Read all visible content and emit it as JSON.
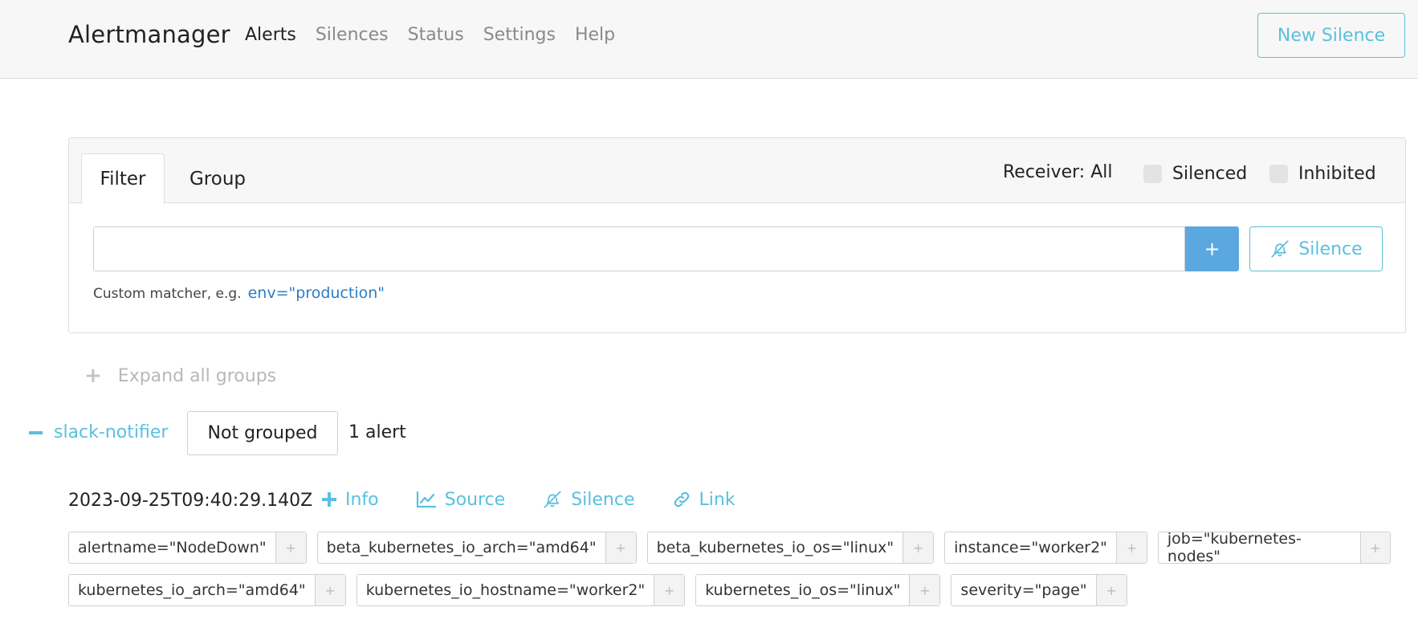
{
  "navbar": {
    "brand": "Alertmanager",
    "links": [
      "Alerts",
      "Silences",
      "Status",
      "Settings",
      "Help"
    ],
    "active_link": "Alerts",
    "new_silence_label": "New Silence"
  },
  "filter": {
    "tabs": [
      "Filter",
      "Group"
    ],
    "active_tab": "Filter",
    "receiver_label": "Receiver: All",
    "silenced_label": "Silenced",
    "inhibited_label": "Inhibited",
    "input_value": "",
    "add_button_label": "+",
    "silence_button_label": "Silence",
    "hint_text": "Custom matcher, e.g.",
    "hint_example": "env=\"production\""
  },
  "expand_all_label": "Expand all groups",
  "group": {
    "receiver": "slack-notifier",
    "grouping": "Not grouped",
    "count": "1 alert"
  },
  "alert": {
    "timestamp": "2023-09-25T09:40:29.140Z",
    "actions": {
      "info": "Info",
      "source": "Source",
      "silence": "Silence",
      "link": "Link"
    },
    "labels_row1": [
      "alertname=\"NodeDown\"",
      "beta_kubernetes_io_arch=\"amd64\"",
      "beta_kubernetes_io_os=\"linux\"",
      "instance=\"worker2\"",
      "job=\"kubernetes-nodes\""
    ],
    "labels_row2": [
      "kubernetes_io_arch=\"amd64\"",
      "kubernetes_io_hostname=\"worker2\"",
      "kubernetes_io_os=\"linux\"",
      "severity=\"page\""
    ],
    "label_add_glyph": "+"
  },
  "colors": {
    "accent": "#5bc0de",
    "primary_button": "#5ba7e0",
    "link": "#2a7ec8",
    "navbar_bg": "#f7f7f7"
  }
}
